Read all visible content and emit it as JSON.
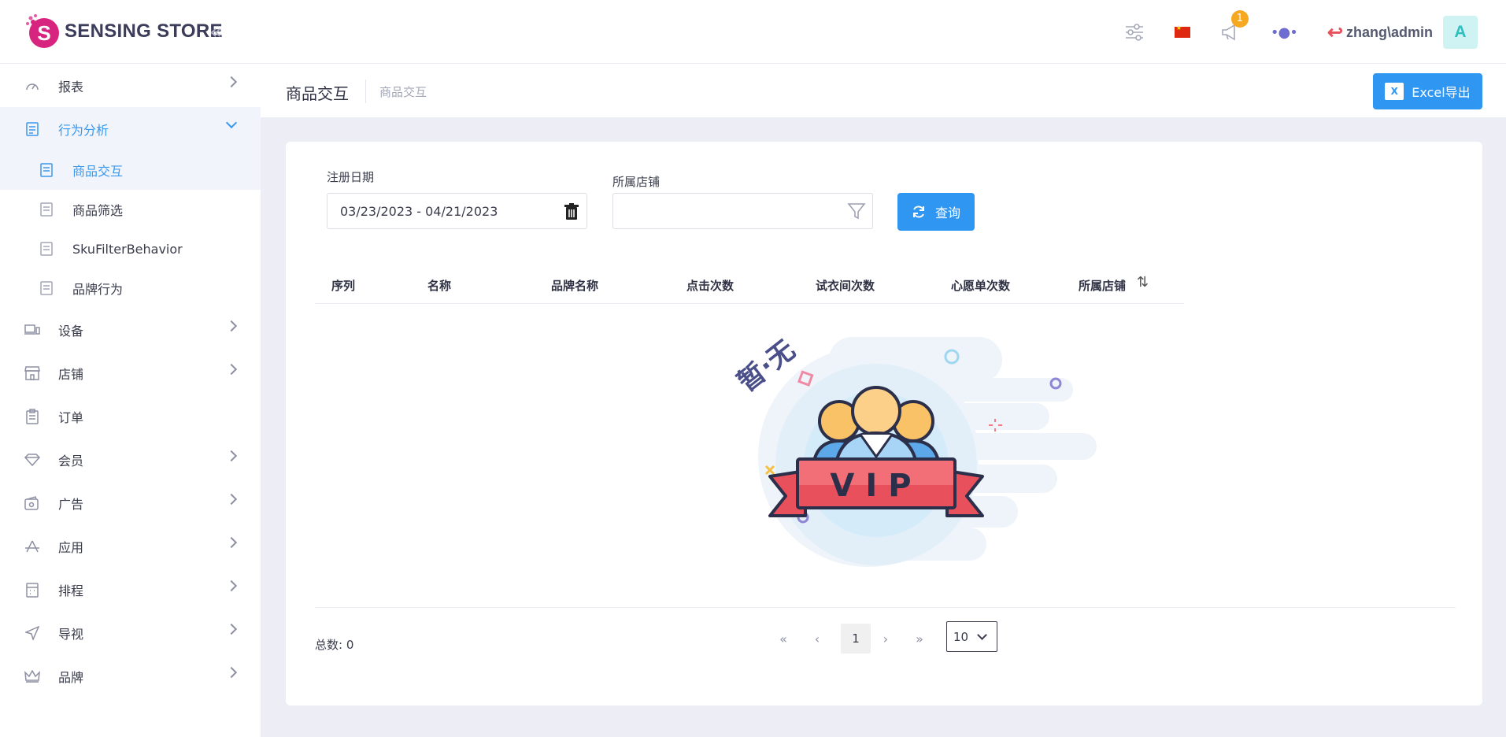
{
  "brand": {
    "name": "SENSING STORE"
  },
  "topbar": {
    "notification_count": "1",
    "user_name": "zhang\\admin",
    "avatar_initial": "A"
  },
  "sidebar": {
    "items": [
      {
        "label": "报表",
        "icon": "gauge-icon"
      },
      {
        "label": "行为分析",
        "icon": "document-icon",
        "open": true,
        "children": [
          {
            "label": "商品交互",
            "active": true
          },
          {
            "label": "商品筛选"
          },
          {
            "label": "SkuFilterBehavior"
          },
          {
            "label": "品牌行为"
          }
        ]
      },
      {
        "label": "设备",
        "icon": "devices-icon"
      },
      {
        "label": "店铺",
        "icon": "store-icon"
      },
      {
        "label": "订单",
        "icon": "clipboard-icon"
      },
      {
        "label": "会员",
        "icon": "diamond-icon"
      },
      {
        "label": "广告",
        "icon": "ad-card-icon"
      },
      {
        "label": "应用",
        "icon": "app-store-icon"
      },
      {
        "label": "排程",
        "icon": "calendar-icon"
      },
      {
        "label": "导视",
        "icon": "navigation-icon"
      },
      {
        "label": "品牌",
        "icon": "crown-icon"
      }
    ]
  },
  "header": {
    "title": "商品交互",
    "breadcrumb": "商品交互",
    "excel_label": "Excel导出"
  },
  "filters": {
    "date_label": "注册日期",
    "date_value": "03/23/2023 - 04/21/2023",
    "store_label": "所属店铺",
    "store_value": "",
    "query_label": "查询"
  },
  "table": {
    "columns": [
      "序列",
      "名称",
      "品牌名称",
      "点击次数",
      "试衣间次数",
      "心愿单次数",
      "所属店铺"
    ],
    "rows": []
  },
  "empty_state": {
    "text": "暂·无",
    "badge": "VIP"
  },
  "pagination": {
    "total_label": "总数: 0",
    "current_page": "1",
    "page_size": "10"
  },
  "colors": {
    "primary": "#2f96f1",
    "active_text": "#3a98ef",
    "badge": "#f7a823",
    "vip_red": "#e8505b"
  }
}
